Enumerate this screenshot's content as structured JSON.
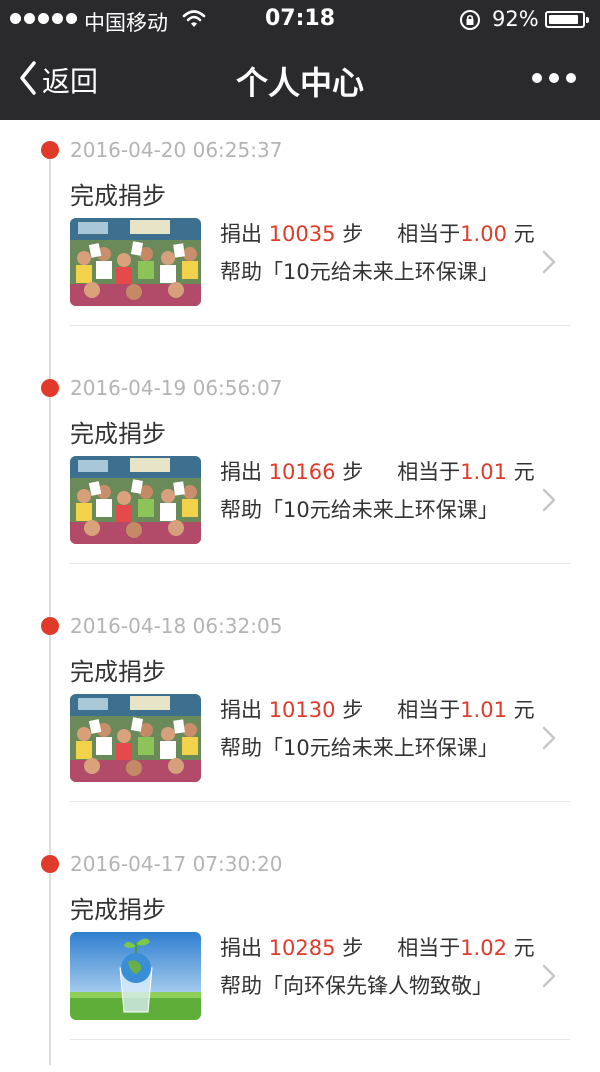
{
  "status_bar": {
    "carrier": "中国移动",
    "time": "07:18",
    "battery_text": "92%",
    "battery_level": 0.92,
    "signal_icon": "signal-dots-icon",
    "wifi_icon": "wifi-icon",
    "lock_icon": "rotation-lock-icon",
    "battery_icon": "battery-icon"
  },
  "nav": {
    "back_label": "返回",
    "title": "个人中心",
    "back_icon": "chevron-left-icon",
    "more_icon": "more-dots-icon"
  },
  "colors": {
    "accent": "#e03a2a",
    "header_bg": "#2a2a2c",
    "timestamp": "#b4b4b4",
    "text": "#333333"
  },
  "entries": [
    {
      "timestamp": "2016-04-20 06:25:37",
      "action": "完成捐步",
      "donate_prefix": "捐出",
      "steps": "10035",
      "steps_unit": "步",
      "equiv_prefix": "相当于",
      "amount": "1.00",
      "amount_unit": "元",
      "help_text": "帮助「10元给未来上环保课」",
      "thumbnail": "classroom-children-photo"
    },
    {
      "timestamp": "2016-04-19 06:56:07",
      "action": "完成捐步",
      "donate_prefix": "捐出",
      "steps": "10166",
      "steps_unit": "步",
      "equiv_prefix": "相当于",
      "amount": "1.01",
      "amount_unit": "元",
      "help_text": "帮助「10元给未来上环保课」",
      "thumbnail": "classroom-children-photo"
    },
    {
      "timestamp": "2016-04-18 06:32:05",
      "action": "完成捐步",
      "donate_prefix": "捐出",
      "steps": "10130",
      "steps_unit": "步",
      "equiv_prefix": "相当于",
      "amount": "1.01",
      "amount_unit": "元",
      "help_text": "帮助「10元给未来上环保课」",
      "thumbnail": "classroom-children-photo"
    },
    {
      "timestamp": "2016-04-17 07:30:20",
      "action": "完成捐步",
      "donate_prefix": "捐出",
      "steps": "10285",
      "steps_unit": "步",
      "equiv_prefix": "相当于",
      "amount": "1.02",
      "amount_unit": "元",
      "help_text": "帮助「向环保先锋人物致敬」",
      "thumbnail": "glass-globe-sprout-photo"
    }
  ]
}
